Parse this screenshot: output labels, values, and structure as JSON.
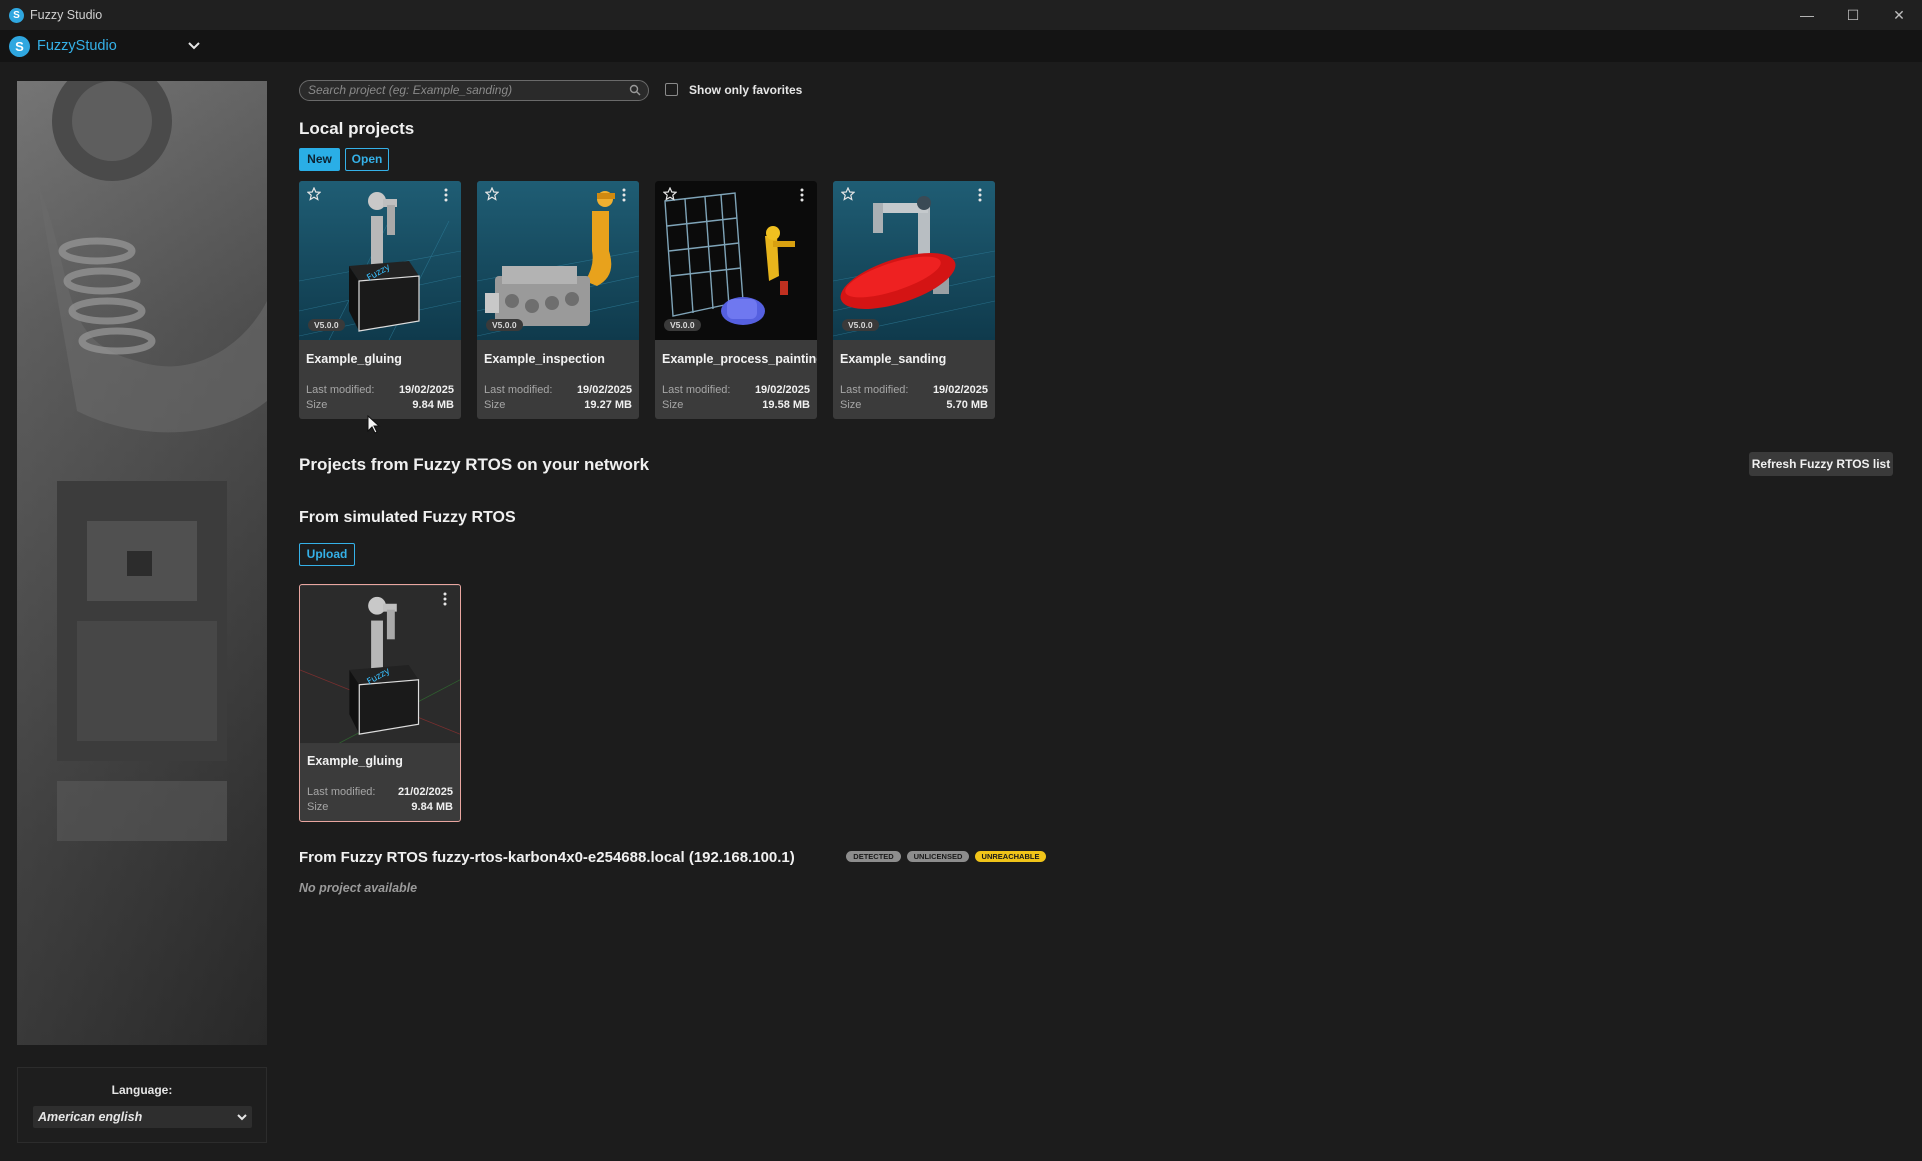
{
  "window": {
    "title": "Fuzzy Studio",
    "controls": [
      "minimize",
      "maximize",
      "close"
    ]
  },
  "appbar": {
    "brand": "FuzzyStudio"
  },
  "search": {
    "placeholder": "Search project (eg: Example_sanding)",
    "value": "",
    "favorites_label": "Show only favorites",
    "favorites_checked": false
  },
  "local": {
    "title": "Local projects",
    "new_label": "New",
    "open_label": "Open",
    "projects": [
      {
        "name": "Example_gluing",
        "version": "V5.0.0",
        "modified_label": "Last modified:",
        "modified": "19/02/2025",
        "size_label": "Size",
        "size": "9.84 MB"
      },
      {
        "name": "Example_inspection",
        "version": "V5.0.0",
        "modified_label": "Last modified:",
        "modified": "19/02/2025",
        "size_label": "Size",
        "size": "19.27 MB"
      },
      {
        "name": "Example_process_painting",
        "version": "V5.0.0",
        "modified_label": "Last modified:",
        "modified": "19/02/2025",
        "size_label": "Size",
        "size": "19.58 MB"
      },
      {
        "name": "Example_sanding",
        "version": "V5.0.0",
        "modified_label": "Last modified:",
        "modified": "19/02/2025",
        "size_label": "Size",
        "size": "5.70 MB"
      }
    ]
  },
  "network": {
    "title": "Projects from Fuzzy RTOS on your network",
    "refresh_label": "Refresh Fuzzy RTOS list",
    "simulated": {
      "title": "From simulated Fuzzy RTOS",
      "upload_label": "Upload",
      "project": {
        "name": "Example_gluing",
        "modified_label": "Last modified:",
        "modified": "21/02/2025",
        "size_label": "Size",
        "size": "9.84 MB"
      }
    },
    "remote": {
      "title": "From Fuzzy RTOS fuzzy-rtos-karbon4x0-e254688.local (192.168.100.1)",
      "badges": [
        {
          "label": "DETECTED",
          "color": "#8d8d8d"
        },
        {
          "label": "UNLICENSED",
          "color": "#8d8d8d"
        },
        {
          "label": "UNREACHABLE",
          "color": "#f0c419"
        }
      ],
      "empty_text": "No project available"
    }
  },
  "language": {
    "label": "Language:",
    "value": "American english"
  },
  "colors": {
    "accent": "#35b1e8",
    "background": "#1c1c1c",
    "card": "#3b3b3b",
    "warning": "#f0c419"
  }
}
